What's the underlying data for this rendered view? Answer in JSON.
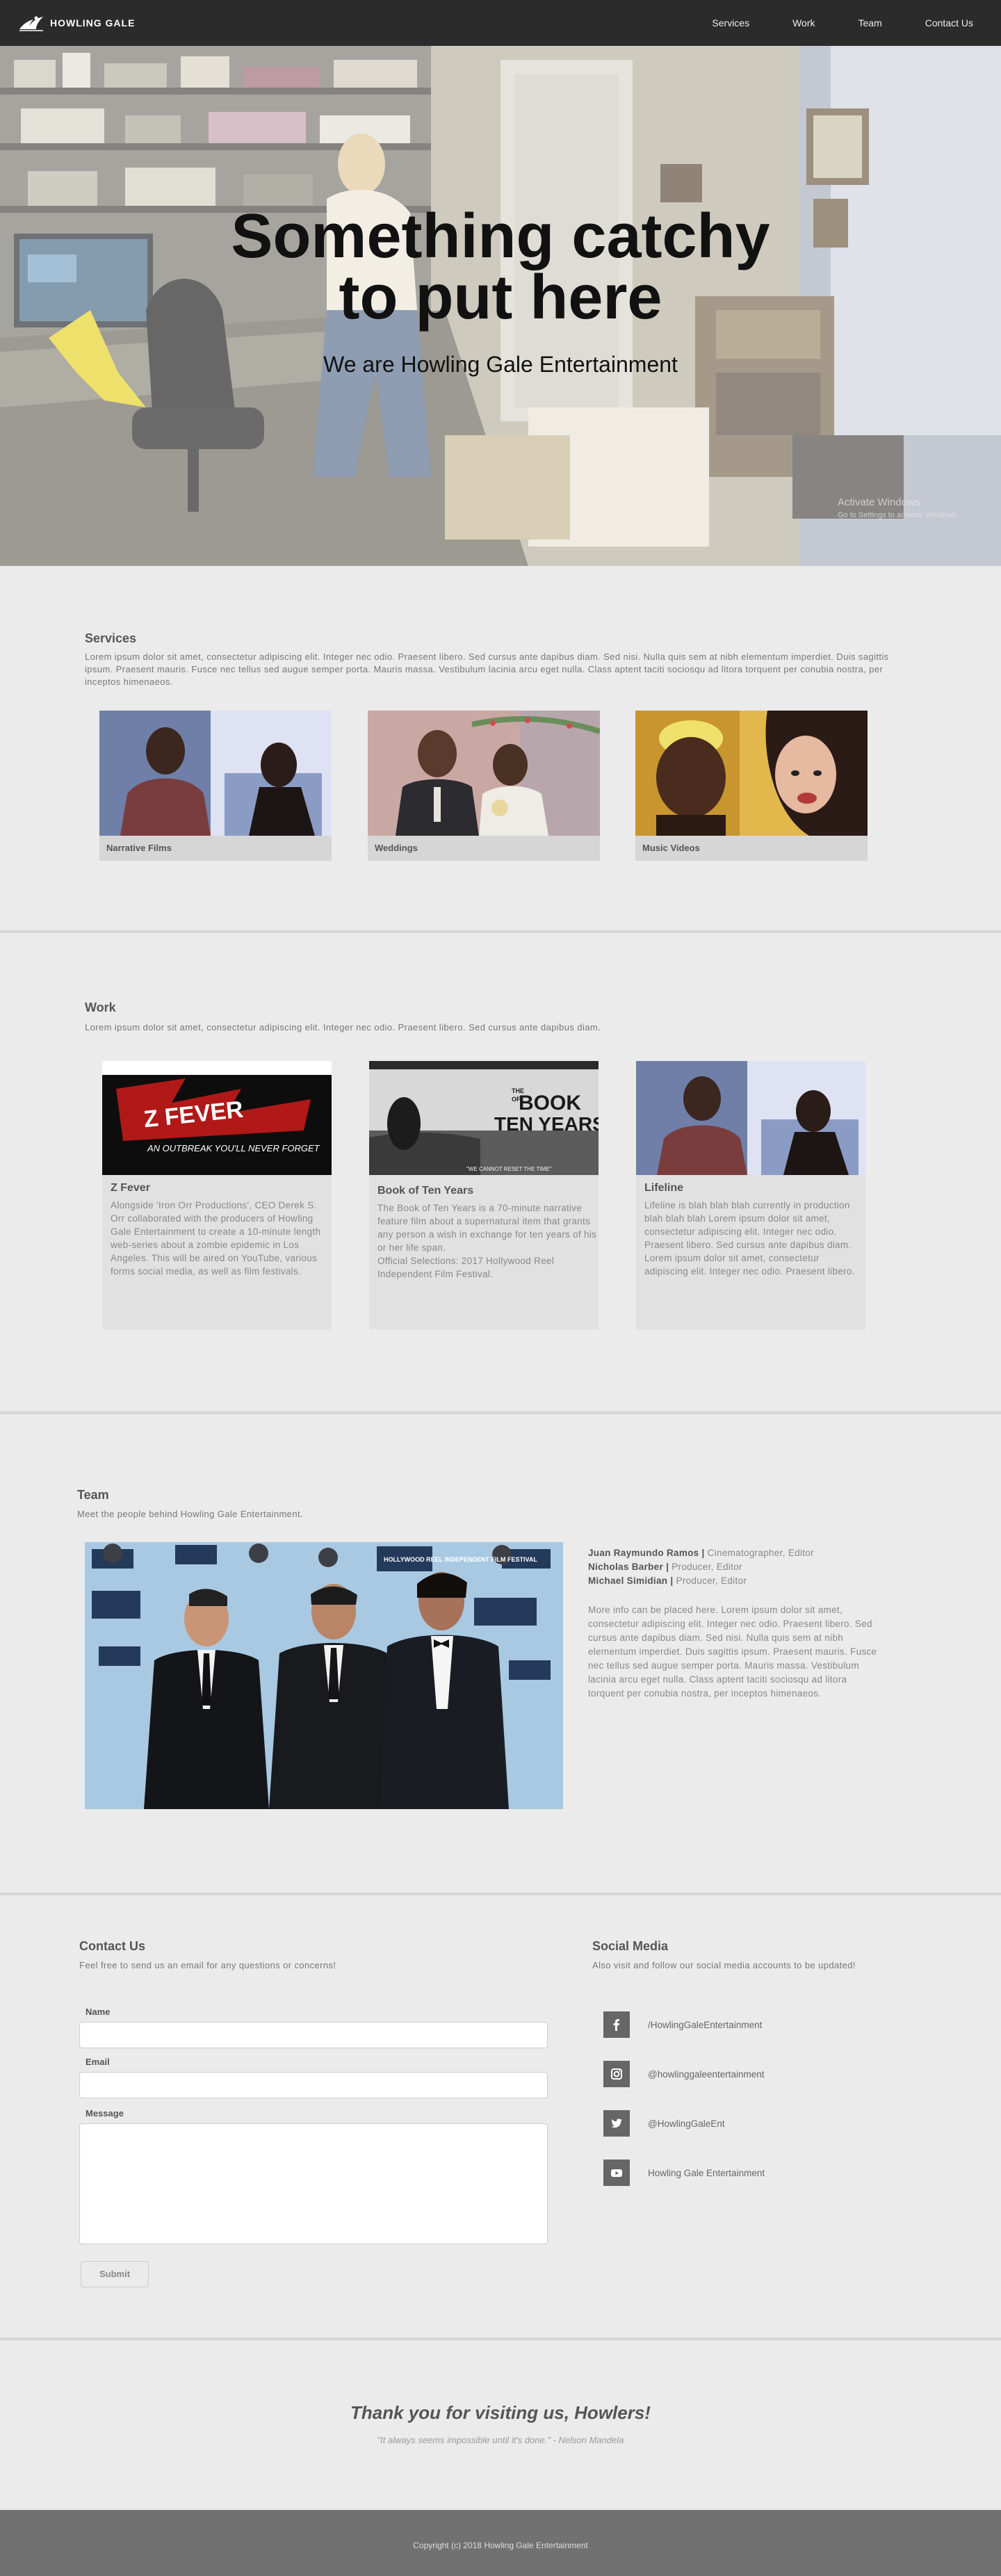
{
  "nav": {
    "brand": "HOWLING GALE",
    "links": [
      "Services",
      "Work",
      "Team",
      "Contact Us"
    ]
  },
  "hero": {
    "title_line1": "Something catchy",
    "title_line2": "to put here",
    "subtitle": "We are Howling Gale Entertainment",
    "watermark_line1": "Activate Windows",
    "watermark_line2": "Go to Settings to activate Windows."
  },
  "services": {
    "title": "Services",
    "text": "Lorem ipsum dolor sit amet, consectetur adipiscing elit. Integer nec odio. Praesent libero. Sed cursus ante dapibus diam. Sed nisi. Nulla quis sem at nibh elementum imperdiet. Duis sagittis ipsum. Praesent mauris. Fusce nec tellus sed augue semper porta. Mauris massa. Vestibulum lacinia arcu eget nulla. Class aptent taciti sociosqu ad litora torquent per conubia nostra, per inceptos himenaeos.",
    "cards": [
      "Narrative Films",
      "Weddings",
      "Music Videos"
    ]
  },
  "work": {
    "title": "Work",
    "text": "Lorem ipsum dolor sit amet, consectetur adipiscing elit. Integer nec odio. Praesent libero. Sed cursus ante dapibus diam.",
    "cards": [
      {
        "title": "Z Fever",
        "desc": "Alongside 'Iron Orr Productions', CEO Derek S. Orr collaborated with the producers of Howling Gale Entertainment to create a 10-minute length web-series about a zombie epidemic in Los Angeles. This will be aired on YouTube, various forms social media, as well as film festivals.",
        "poster_title": "Z FEVER",
        "poster_tag": "AN OUTBREAK YOU'LL NEVER FORGET"
      },
      {
        "title": "Book of Ten Years",
        "desc": "The Book of Ten Years is a 70-minute narrative feature film about a supernatural item that grants any person a wish in exchange for ten years of his or her life span.",
        "desc2": "Official Selections: 2017 Hollywood Reel Independent Film Festival.",
        "poster_the": "THE",
        "poster_book": "BOOK",
        "poster_of": "OF",
        "poster_ten": "TEN YEARS",
        "poster_tag": "\"WE CANNOT RESET THE TIME\""
      },
      {
        "title": "Lifeline",
        "desc": "Lifeline is blah blah blah currently in production blah blah blah Lorem ipsum dolor sit amet, consectetur adipiscing elit. Integer nec odio. Praesent libero. Sed cursus ante dapibus diam. Lorem ipsum dolor sit amet, consectetur adipiscing elit. Integer nec odio. Praesent libero."
      }
    ]
  },
  "team": {
    "title": "Team",
    "subtitle": "Meet the people behind Howling Gale Entertainment.",
    "members": [
      {
        "name": "Juan Raymundo Ramos |",
        "role": " Cinematographer, Editor"
      },
      {
        "name": "Nicholas Barber |",
        "role": " Producer, Editor"
      },
      {
        "name": "Michael Simidian |",
        "role": " Producer, Editor"
      }
    ],
    "more": "More info can be placed here. Lorem ipsum dolor sit amet, consectetur adipiscing elit. Integer nec odio. Praesent libero. Sed cursus ante dapibus diam. Sed nisi. Nulla quis sem at nibh elementum imperdiet. Duis sagittis ipsum. Praesent mauris. Fusce nec tellus sed augue semper porta. Mauris massa. Vestibulum lacinia arcu eget nulla. Class aptent taciti sociosqu ad litora torquent per conubia nostra, per inceptos himenaeos.",
    "backdrop_text": "HOLLYWOOD REEL INDEPENDENT FILM FESTIVAL"
  },
  "contact": {
    "title": "Contact Us",
    "subtitle": "Feel free to send us an email for any questions or concerns!",
    "name_label": "Name",
    "email_label": "Email",
    "message_label": "Message",
    "submit_label": "Submit"
  },
  "social": {
    "title": "Social Media",
    "subtitle": "Also visit and follow our social media accounts to be updated!",
    "items": [
      {
        "icon": "facebook-icon",
        "label": "/HowlingGaleEntertainment"
      },
      {
        "icon": "instagram-icon",
        "label": "@howlinggaleentertainment"
      },
      {
        "icon": "twitter-icon",
        "label": "@HowlingGaleEnt"
      },
      {
        "icon": "youtube-icon",
        "label": "Howling Gale Entertainment"
      }
    ]
  },
  "closing": {
    "thanks": "Thank you for visiting us, Howlers!",
    "quote": "\"It always seems impossible until it's done.\" - Nelson Mandela"
  },
  "footer": {
    "copyright": "Copyright (c) 2018 Howling Gale Entertainment"
  },
  "colors": {
    "nav_bg": "#2b2b2b",
    "page_bg": "#ebebeb",
    "footer_bg": "#717171",
    "card_bg": "#d6d6d6",
    "icon_bg": "#666666"
  }
}
